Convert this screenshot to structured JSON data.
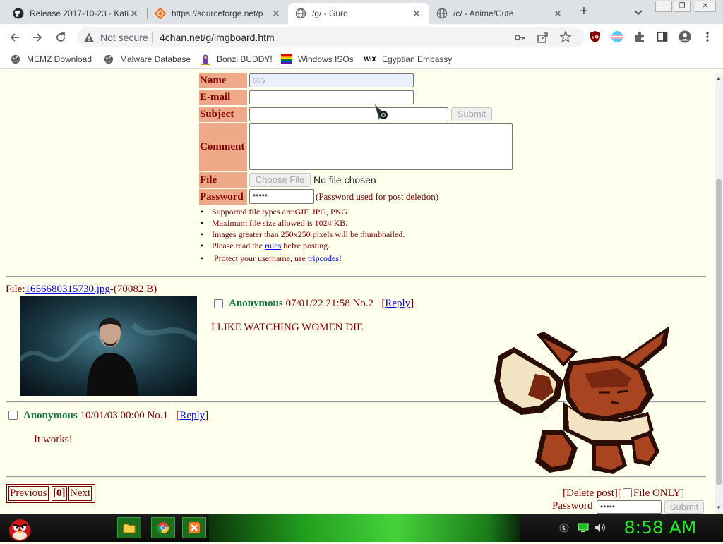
{
  "tabs": [
    {
      "title": "Release 2017-10-23 · Kati",
      "icon": "github-icon"
    },
    {
      "title": "https://sourceforge.net/p",
      "icon": "sourceforge-icon"
    },
    {
      "title": "/g/ - Guro",
      "icon": "globe-icon",
      "active": true
    },
    {
      "title": "/c/ - Anime/Cute",
      "icon": "globe-icon"
    }
  ],
  "address": {
    "security": "Not secure",
    "url": "4chan.net/g/imgboard.htm"
  },
  "bookmarks": [
    {
      "label": "MEMZ Download",
      "icon": "globe-icon"
    },
    {
      "label": "Malware Database",
      "icon": "globe-icon"
    },
    {
      "label": "Bonzi BUDDY!",
      "icon": "bonzi-icon"
    },
    {
      "label": "Windows ISOs",
      "icon": "windows-flag-icon"
    },
    {
      "label": "Egyptian Embassy",
      "icon": "wix-icon"
    }
  ],
  "form": {
    "name_label": "Name",
    "name_value": "soy",
    "email_label": "E-mail",
    "subject_label": "Subject",
    "submit_label": "Submit",
    "comment_label": "Comment",
    "file_label": "File",
    "choose_file_label": "Choose File",
    "no_file_text": "No file chosen",
    "password_label": "Password",
    "password_value": "•••••",
    "password_note": "(Password used for post deletion)"
  },
  "rules": {
    "filetypes": "Supported file types are:GIF, JPG, PNG",
    "maxsize": "Maximum file size allowed is 1024 KB.",
    "thumbs": "Images greater than 250x250 pixels will be thumbnailed.",
    "read_prefix": "Please read the",
    "rules_link": "rules",
    "read_suffix": "befre posting.",
    "protect_prefix": "Protect your username, use",
    "tripcodes_link": "tripcodes",
    "protect_suffix": "!"
  },
  "posts": [
    {
      "file_prefix": "File:",
      "file_name": "1656680315730.jpg",
      "file_size": "-(70082 B)",
      "name": "Anonymous",
      "date": "07/01/22 21:58",
      "number": "No.2",
      "reply": "Reply",
      "comment": "I LIKE WATCHING WOMEN DIE"
    },
    {
      "name": "Anonymous",
      "date": "10/01/03 00:00",
      "number": "No.1",
      "reply": "Reply",
      "comment": "It works!"
    }
  ],
  "pager": {
    "previous": "Previous",
    "current": "[0]",
    "next": "Next"
  },
  "delete": {
    "delete_post": "[Delete post][",
    "file_only": "File ONLY]",
    "password_label": "Password",
    "password_value": "•••••",
    "submit_label": "Submit"
  },
  "taskbar": {
    "clock": "8:58 AM",
    "apps": [
      "folder-icon",
      "chrome-icon",
      "xampp-icon"
    ]
  },
  "colors": {
    "post_bg": "#ffffee",
    "label_bg": "#eeaa88",
    "text": "#800000",
    "name": "#117743",
    "link": "#0000ee",
    "clock": "#26e826"
  }
}
